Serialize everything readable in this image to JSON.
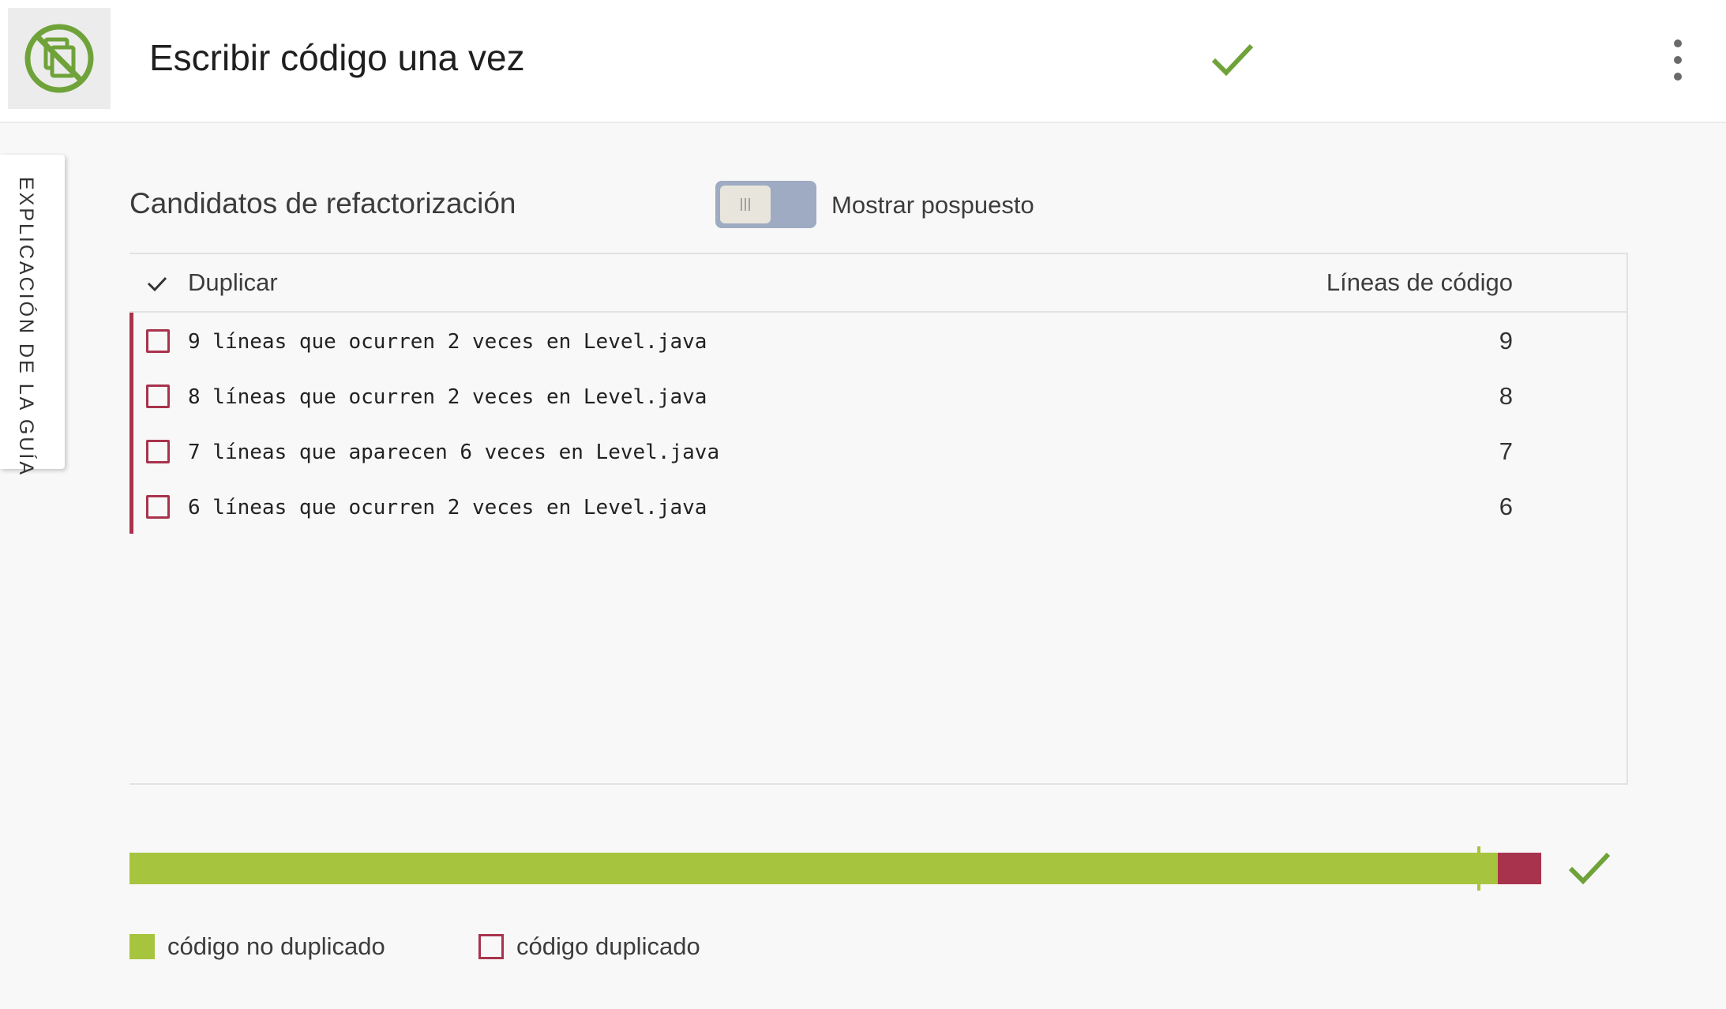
{
  "header": {
    "title": "Escribir código una vez",
    "logo_icon": "no-copy-icon",
    "status_icon": "checkmark-icon",
    "menu_icon": "more-vert-icon"
  },
  "side_tab": {
    "label": "EXPLICACIÓN DE LA GUÍA"
  },
  "section": {
    "title": "Candidatos de refactorización",
    "toggle_label": "Mostrar pospuesto",
    "toggle_on": false
  },
  "table": {
    "columns": [
      "Duplicar",
      "Líneas de código"
    ],
    "rows": [
      {
        "text": "9 líneas que ocurren 2 veces en Level.java",
        "lines": "9"
      },
      {
        "text": "8 líneas que ocurren 2 veces en Level.java",
        "lines": "8"
      },
      {
        "text": "7 líneas que aparecen 6 veces en Level.java",
        "lines": "7"
      },
      {
        "text": "6 líneas que ocurren 2 veces en Level.java",
        "lines": "6"
      }
    ]
  },
  "progress": {
    "non_duplicated_fraction": 0.969,
    "target_fraction": 0.956
  },
  "legend": [
    {
      "label": "código no duplicado",
      "kind": "fill"
    },
    {
      "label": "código duplicado",
      "kind": "outline"
    }
  ],
  "colors": {
    "accent_green": "#a7c43f",
    "check_green": "#6fa33a",
    "duplicate_red": "#a8334d",
    "toggle_track": "#9eabc2"
  }
}
